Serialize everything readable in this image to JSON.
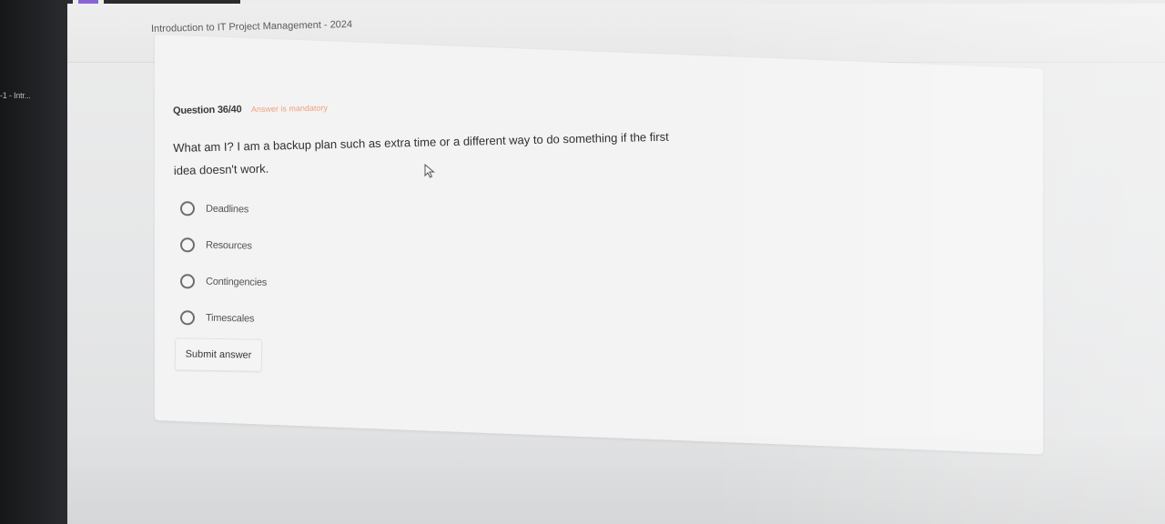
{
  "taskbar": {
    "tab_label": "-1 - Intr..."
  },
  "header": {
    "course_title": "Introduction to IT Project Management - 2024"
  },
  "question": {
    "number_label": "Question 36/40",
    "mandatory_label": "Answer is mandatory",
    "text": "What am I? I am a backup plan such as extra time or a different way to do something if the first idea doesn't work.",
    "options": [
      {
        "label": "Deadlines",
        "selected": false
      },
      {
        "label": "Resources",
        "selected": false
      },
      {
        "label": "Contingencies",
        "selected": false
      },
      {
        "label": "Timescales",
        "selected": false
      }
    ],
    "submit_label": "Submit answer"
  },
  "colors": {
    "accent": "#8a63d6",
    "mandatory": "#f0a07a"
  },
  "icons": {
    "cursor": "mouse-pointer-icon"
  }
}
